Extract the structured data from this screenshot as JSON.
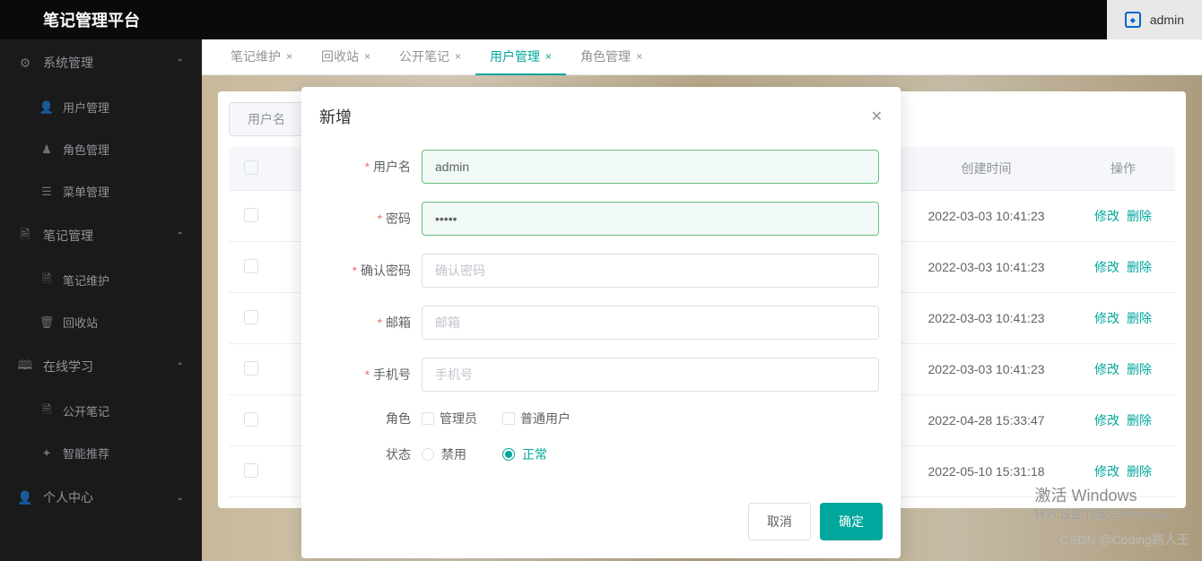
{
  "header": {
    "title": "笔记管理平台",
    "username": "admin"
  },
  "sidebar": {
    "groups": [
      {
        "label": "系统管理",
        "items": [
          {
            "label": "用户管理"
          },
          {
            "label": "角色管理"
          },
          {
            "label": "菜单管理"
          }
        ]
      },
      {
        "label": "笔记管理",
        "items": [
          {
            "label": "笔记维护"
          },
          {
            "label": "回收站"
          }
        ]
      },
      {
        "label": "在线学习",
        "items": [
          {
            "label": "公开笔记"
          },
          {
            "label": "智能推荐"
          }
        ]
      },
      {
        "label": "个人中心",
        "items": []
      }
    ]
  },
  "tabs": [
    {
      "label": "笔记维护"
    },
    {
      "label": "回收站"
    },
    {
      "label": "公开笔记"
    },
    {
      "label": "用户管理",
      "active": true
    },
    {
      "label": "角色管理"
    }
  ],
  "search": {
    "label": "用户名"
  },
  "table": {
    "headers": {
      "created": "创建时间",
      "ops": "操作"
    },
    "rows": [
      {
        "created": "2022-03-03 10:41:23"
      },
      {
        "created": "2022-03-03 10:41:23"
      },
      {
        "created": "2022-03-03 10:41:23"
      },
      {
        "created": "2022-03-03 10:41:23"
      },
      {
        "created": "2022-04-28 15:33:47"
      },
      {
        "created": "2022-05-10 15:31:18"
      }
    ],
    "actions": {
      "edit": "修改",
      "del": "删除"
    }
  },
  "modal": {
    "title": "新增",
    "fields": {
      "username": {
        "label": "用户名",
        "value": "admin"
      },
      "password": {
        "label": "密码",
        "value": "•••••"
      },
      "confirm": {
        "label": "确认密码",
        "placeholder": "确认密码"
      },
      "email": {
        "label": "邮箱",
        "placeholder": "邮箱"
      },
      "phone": {
        "label": "手机号",
        "placeholder": "手机号"
      },
      "role": {
        "label": "角色",
        "options": [
          "管理员",
          "普通用户"
        ]
      },
      "status": {
        "label": "状态",
        "options": [
          "禁用",
          "正常"
        ],
        "selected": "正常"
      }
    },
    "buttons": {
      "cancel": "取消",
      "confirm": "确定"
    }
  },
  "watermark": {
    "line1": "激活 Windows",
    "line2": "转到\"设置\"以激活 Windows。",
    "csdn": "CSDN @Coding路人王"
  }
}
